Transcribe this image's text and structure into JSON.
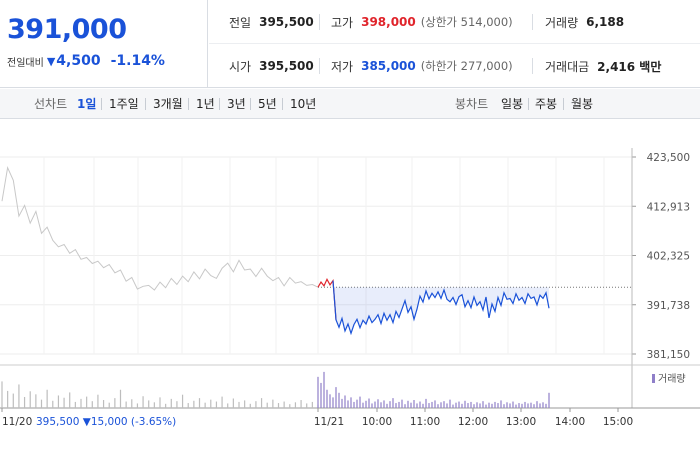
{
  "header": {
    "current_price": "391,000",
    "change_label": "전일대비",
    "change_direction_icon": "down-triangle-icon",
    "change_amount": "4,500",
    "change_rate": "-1.14%",
    "stats": [
      [
        {
          "label": "전일",
          "value": "395,500",
          "tone": "normal",
          "limit": ""
        },
        {
          "label": "고가",
          "value": "398,000",
          "tone": "up",
          "limit": "(상한가 514,000)"
        },
        {
          "label": "거래량",
          "value": "6,188",
          "tone": "normal",
          "limit": ""
        }
      ],
      [
        {
          "label": "시가",
          "value": "395,500",
          "tone": "normal",
          "limit": ""
        },
        {
          "label": "저가",
          "value": "385,000",
          "tone": "down",
          "limit": "(하한가 277,000)"
        },
        {
          "label": "거래대금",
          "value": "2,416 백만",
          "tone": "normal",
          "limit": ""
        }
      ]
    ]
  },
  "tabs": {
    "line_label": "선차트",
    "line_periods": [
      "1일",
      "1주일",
      "3개월",
      "1년",
      "3년",
      "5년",
      "10년"
    ],
    "active_period": "1일",
    "candle_label": "봉차트",
    "candle_periods": [
      "일봉",
      "주봉",
      "월봉"
    ]
  },
  "colors": {
    "up": "#e0242b",
    "down": "#1a52d8",
    "prev_day_line": "#c8c8c8",
    "volume_bar": "#8f7fc9"
  },
  "chart_data": {
    "type": "line",
    "y_ticks": [
      "423,500",
      "412,913",
      "402,325",
      "391,738",
      "381,150"
    ],
    "ylim": [
      381150,
      423500
    ],
    "grid": true,
    "x_ticks": [
      "11/20",
      "11/21",
      "10:00",
      "11:00",
      "12:00",
      "13:00",
      "14:00",
      "15:00"
    ],
    "reference_price": 395500,
    "legend": "거래량",
    "footer_note": {
      "date": "11/20",
      "close": "395,500",
      "change": "▼15,000",
      "rate": "(-3.65%)"
    },
    "series": [
      {
        "role": "previous_day",
        "date": "11/20",
        "values": [
          414000,
          421200,
          418500,
          410800,
          413100,
          409300,
          411800,
          407100,
          408400,
          405600,
          404200,
          404700,
          402800,
          403600,
          401500,
          401900,
          400600,
          401100,
          399700,
          400400,
          398600,
          399200,
          396800,
          397600,
          395100,
          395700,
          395900,
          394900,
          396600,
          395400,
          397400,
          396100,
          397900,
          396700,
          398800,
          397300,
          399400,
          398000,
          397400,
          399600,
          400700,
          398800,
          401300,
          399200,
          399400,
          397800,
          399600,
          397900,
          396900,
          397600,
          395800,
          397600,
          396400,
          396700,
          395900,
          396100,
          395500
        ]
      },
      {
        "role": "today",
        "date": "11/21",
        "values": [
          395500,
          396600,
          395800,
          397200,
          396000,
          396900,
          388500,
          386900,
          388800,
          386100,
          387600,
          385600,
          387500,
          388600,
          386800,
          388400,
          387600,
          389300,
          387900,
          388600,
          389600,
          387700,
          389900,
          388400,
          389600,
          387900,
          390300,
          389000,
          390800,
          392600,
          390100,
          391300,
          388600,
          390800,
          393600,
          392300,
          394700,
          393000,
          394200,
          393300,
          394500,
          393100,
          394900,
          392900,
          392400,
          393300,
          391800,
          393500,
          393900,
          391300,
          392600,
          391100,
          393400,
          391600,
          392400,
          390600,
          393400,
          388900,
          391900,
          390300,
          393300,
          391600,
          394300,
          392900,
          393100,
          392000,
          394100,
          392700,
          393300,
          392000,
          394100,
          393100,
          393400,
          391700,
          393800,
          393100,
          394300,
          391000
        ]
      }
    ],
    "volume": {
      "previous_day": [
        70,
        45,
        38,
        62,
        29,
        44,
        36,
        22,
        48,
        19,
        33,
        27,
        41,
        16,
        24,
        30,
        18,
        35,
        21,
        14,
        26,
        48,
        17,
        23,
        12,
        31,
        20,
        15,
        28,
        11,
        24,
        18,
        35,
        13,
        19,
        26,
        14,
        22,
        17,
        30,
        12,
        25,
        16,
        20,
        11,
        18,
        26,
        14,
        22,
        13,
        17,
        10,
        15,
        21,
        12,
        16,
        9
      ],
      "today": [
        82,
        66,
        95,
        48,
        36,
        28,
        55,
        40,
        24,
        33,
        20,
        28,
        16,
        22,
        30,
        14,
        19,
        25,
        12,
        17,
        23,
        15,
        20,
        11,
        18,
        26,
        13,
        16,
        22,
        10,
        19,
        14,
        21,
        12,
        17,
        11,
        24,
        13,
        16,
        20,
        10,
        15,
        18,
        12,
        22,
        9,
        14,
        17,
        11,
        19,
        13,
        16,
        10,
        15,
        12,
        18,
        9,
        14,
        11,
        16,
        13,
        20,
        10,
        15,
        12,
        17,
        9,
        13,
        11,
        16,
        12,
        14,
        10,
        18,
        12,
        15,
        11,
        40
      ]
    }
  }
}
